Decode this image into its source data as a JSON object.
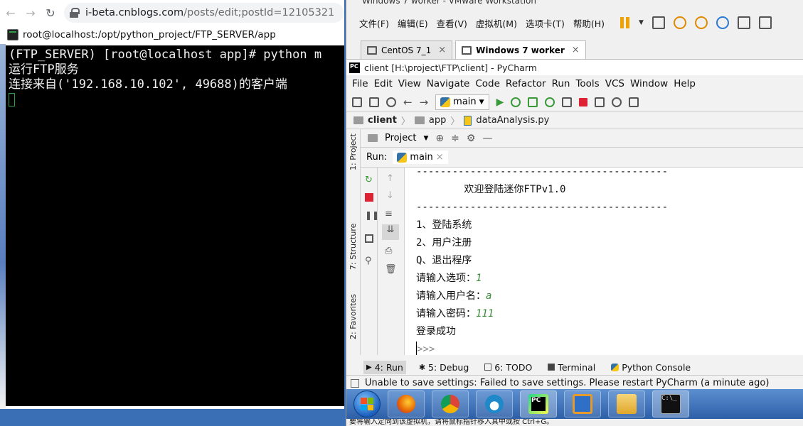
{
  "browser": {
    "url_host": "i-beta.cnblogs.com",
    "url_path": "/posts/edit;postId=12105321"
  },
  "terminal": {
    "title": "root@localhost:/opt/python_project/FTP_SERVER/app",
    "lines": [
      "(FTP_SERVER) [root@localhost app]# python m",
      "运行FTP服务",
      "连接来自('192.168.10.102', 49688)的客户端"
    ]
  },
  "vmware": {
    "title": "Windows 7 worker - VMware Workstation",
    "menu": [
      "文件(F)",
      "编辑(E)",
      "查看(V)",
      "虚拟机(M)",
      "选项卡(T)",
      "帮助(H)"
    ],
    "tabs": [
      {
        "label": "CentOS 7_1",
        "active": false
      },
      {
        "label": "Windows 7 worker",
        "active": true
      }
    ],
    "hint": "要将输入定向到该虚拟机，请将鼠标指针移入其中或按 Ctrl+G。"
  },
  "pycharm": {
    "title": "client [H:\\project\\FTP\\client] - PyCharm",
    "menu": [
      "File",
      "Edit",
      "View",
      "Navigate",
      "Code",
      "Refactor",
      "Run",
      "Tools",
      "VCS",
      "Window",
      "Help"
    ],
    "run_config": "main",
    "breadcrumb": [
      "client",
      "app",
      "dataAnalysis.py"
    ],
    "project_label": "Project",
    "side_labels": {
      "project": "1: Project",
      "structure": "7: Structure",
      "favorites": "2: Favorites"
    },
    "run_label": "Run:",
    "run_tab": "main",
    "console": [
      {
        "text": "------------------------------------------",
        "input": ""
      },
      {
        "text": "        欢迎登陆迷你FTPv1.0",
        "input": ""
      },
      {
        "text": "------------------------------------------",
        "input": ""
      },
      {
        "text": "1、登陆系统",
        "input": ""
      },
      {
        "text": "2、用户注册",
        "input": ""
      },
      {
        "text": "Q、退出程序",
        "input": ""
      },
      {
        "text": "请输入选项：",
        "input": "1"
      },
      {
        "text": "请输入用户名：",
        "input": "a"
      },
      {
        "text": "请输入密码：",
        "input": "111"
      },
      {
        "text": "登录成功",
        "input": ""
      }
    ],
    "prompt": ">>>",
    "bottom_tabs": [
      {
        "label": "4: Run",
        "active": true
      },
      {
        "label": "5: Debug",
        "active": false
      },
      {
        "label": "6: TODO",
        "active": false
      },
      {
        "label": "Terminal",
        "active": false
      },
      {
        "label": "Python Console",
        "active": false
      }
    ],
    "status": "Unable to save settings: Failed to save settings. Please restart PyCharm (a minute ago)"
  },
  "taskbar": {
    "apps": [
      "firefox-icon",
      "chrome-icon",
      "edge-icon",
      "pycharm-icon",
      "filezilla-icon",
      "explorer-icon",
      "cmd-icon"
    ]
  },
  "colors": {
    "terminal_bg": "#000000",
    "terminal_cursor": "#2ea043",
    "console_input": "#3a8a3a",
    "taskbar": "#2d5fa8"
  }
}
